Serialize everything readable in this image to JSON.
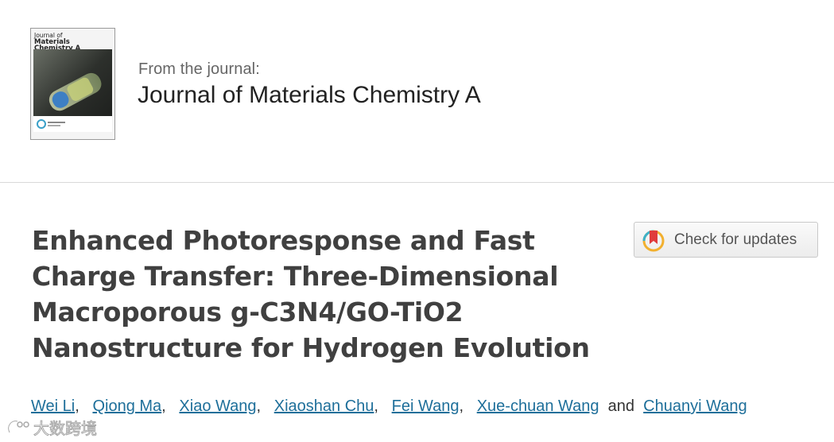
{
  "journal_header": {
    "cover": {
      "title_small": "Journal of",
      "title_big": "Materials Chemistry A"
    },
    "from_label": "From the journal:",
    "journal_name": "Journal of Materials Chemistry A"
  },
  "article": {
    "title_lines": [
      "Enhanced Photoresponse and Fast",
      "Charge Transfer: Three-Dimensional",
      "Macroporous g-C3N4/GO-TiO2",
      "Nanostructure for Hydrogen Evolution"
    ]
  },
  "check_for_updates": {
    "label": "Check for updates",
    "icon": "crossmark-icon"
  },
  "authors": {
    "list": [
      "Wei Li",
      "Qiong Ma",
      "Xiao Wang",
      "Xiaoshan Chu",
      "Fei Wang",
      "Xue-chuan Wang",
      "Chuanyi Wang"
    ],
    "separator": ",",
    "conjunction": "and"
  },
  "watermark": {
    "text": "大数跨境"
  },
  "colors": {
    "title": "#404040",
    "link": "#1e6f9a",
    "journal_name": "#222222",
    "label": "#666666"
  }
}
